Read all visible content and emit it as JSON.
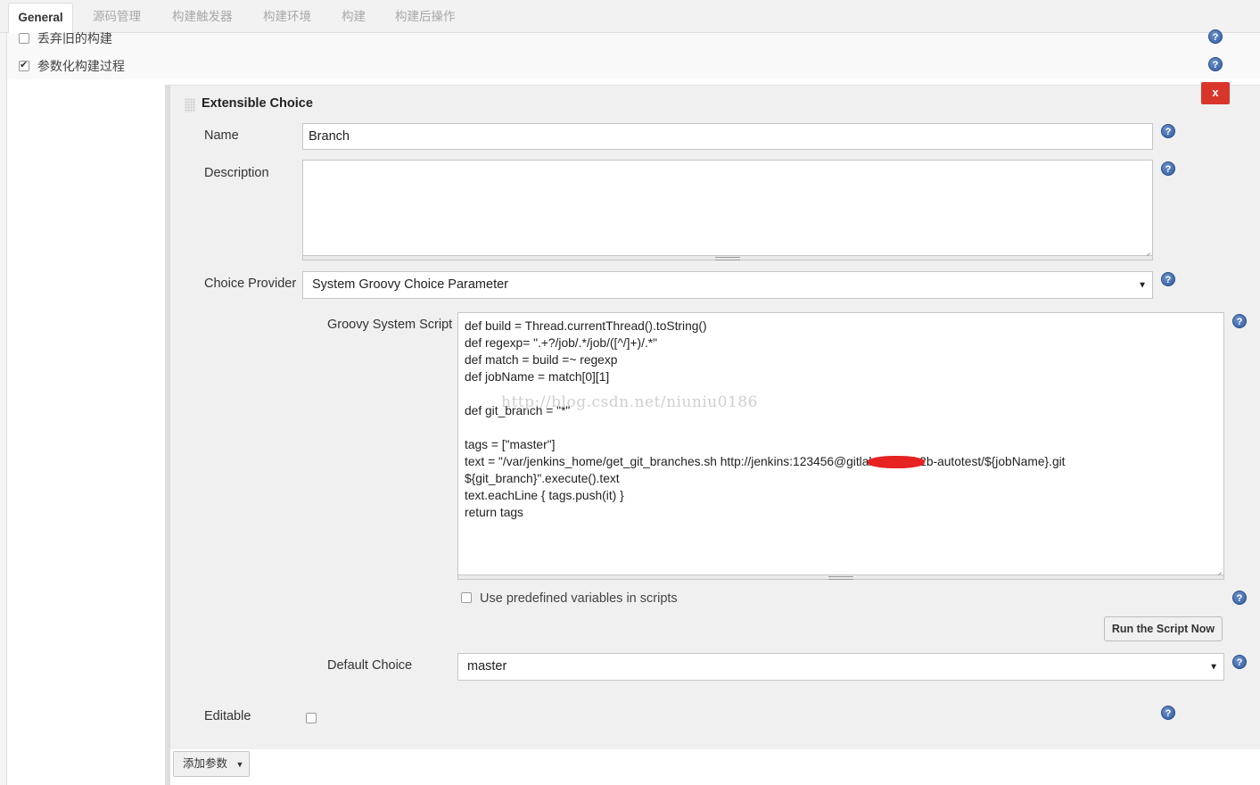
{
  "tabs": [
    {
      "label": "General",
      "active": true
    },
    {
      "label": "源码管理",
      "active": false
    },
    {
      "label": "构建触发器",
      "active": false
    },
    {
      "label": "构建环境",
      "active": false
    },
    {
      "label": "构建",
      "active": false
    },
    {
      "label": "构建后操作",
      "active": false
    }
  ],
  "options": {
    "discard_old": {
      "label": "丢弃旧的构建",
      "checked": false
    },
    "parameterized": {
      "label": "参数化构建过程",
      "checked": true
    }
  },
  "parameter": {
    "title": "Extensible Choice",
    "delete_label": "x",
    "name": {
      "label": "Name",
      "value": "Branch"
    },
    "description": {
      "label": "Description",
      "value": ""
    },
    "choice_provider": {
      "label": "Choice Provider",
      "value": "System Groovy Choice Parameter"
    },
    "groovy_script": {
      "label": "Groovy System Script",
      "lines": [
        "def build = Thread.currentThread().toString()",
        "def regexp= \".+?/job/.*/job/([^/]+)/.*\"",
        "def match = build  =~ regexp",
        "def jobName = match[0][1]",
        "",
        "def git_branch = \"*\"",
        "",
        "tags = [\"master\"]",
        "text = \"/var/jenkins_home/get_git_branches.sh http://jenkins:123456@gitlab.        .com/b2b-autotest/${jobName}.git",
        "${git_branch}\".execute().text",
        "text.eachLine { tags.push(it) }",
        "return tags"
      ]
    },
    "watermark": "http://blog.csdn.net/niuniu0186",
    "use_predefined": {
      "label": "Use predefined variables in scripts",
      "checked": false
    },
    "run_script_label": "Run the Script Now",
    "default_choice": {
      "label": "Default Choice",
      "value": "master"
    },
    "editable": {
      "label": "Editable",
      "checked": false
    }
  },
  "add_param_label": "添加参数",
  "icons": {
    "help": "help-icon",
    "dropdown": "chevron-down-icon",
    "grip": "drag-handle-icon"
  },
  "colors": {
    "delete_button": "#d9362b",
    "help_icon": "#2d5aa0",
    "redaction": "#e62222"
  }
}
